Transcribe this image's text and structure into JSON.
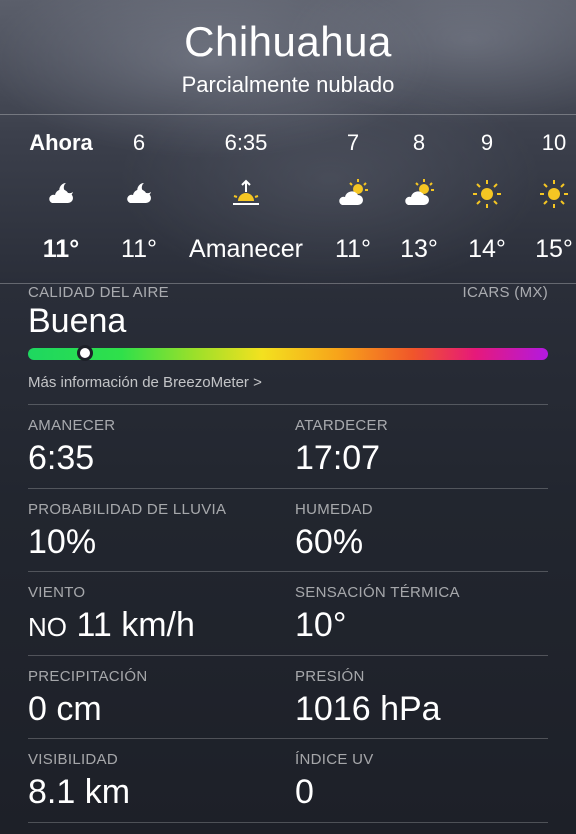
{
  "header": {
    "city": "Chihuahua",
    "condition": "Parcialmente nublado"
  },
  "hourly": [
    {
      "label": "Ahora",
      "icon": "partly-cloudy-night-icon",
      "temp": "11°",
      "bold": true
    },
    {
      "label": "6",
      "icon": "partly-cloudy-night-icon",
      "temp": "11°",
      "bold": false
    },
    {
      "label": "6:35",
      "icon": "sunrise-icon",
      "temp": "Amanecer",
      "bold": false
    },
    {
      "label": "7",
      "icon": "partly-sunny-icon",
      "temp": "11°",
      "bold": false
    },
    {
      "label": "8",
      "icon": "partly-sunny-icon",
      "temp": "13°",
      "bold": false
    },
    {
      "label": "9",
      "icon": "sun-icon",
      "temp": "14°",
      "bold": false
    },
    {
      "label": "10",
      "icon": "sun-icon",
      "temp": "15°",
      "bold": false
    }
  ],
  "air_quality": {
    "label": "CALIDAD DEL AIRE",
    "scale": "ICARS (MX)",
    "value": "Buena",
    "level_fraction": 0.11,
    "more_info": "Más información de BreezoMeter >"
  },
  "details": {
    "sunrise": {
      "label": "AMANECER",
      "value": "6:35"
    },
    "sunset": {
      "label": "ATARDECER",
      "value": "17:07"
    },
    "rain_chance": {
      "label": "PROBABILIDAD DE LLUVIA",
      "value": "10%"
    },
    "humidity": {
      "label": "HUMEDAD",
      "value": "60%"
    },
    "wind": {
      "label": "VIENTO",
      "direction": "NO",
      "value": "11 km/h"
    },
    "feels_like": {
      "label": "SENSACIÓN TÉRMICA",
      "value": "10°"
    },
    "precipitation": {
      "label": "PRECIPITACIÓN",
      "value": "0 cm"
    },
    "pressure": {
      "label": "PRESIÓN",
      "value": "1016 hPa"
    },
    "visibility": {
      "label": "VISIBILIDAD",
      "value": "8.1 km"
    },
    "uv_index": {
      "label": "ÍNDICE UV",
      "value": "0"
    }
  }
}
